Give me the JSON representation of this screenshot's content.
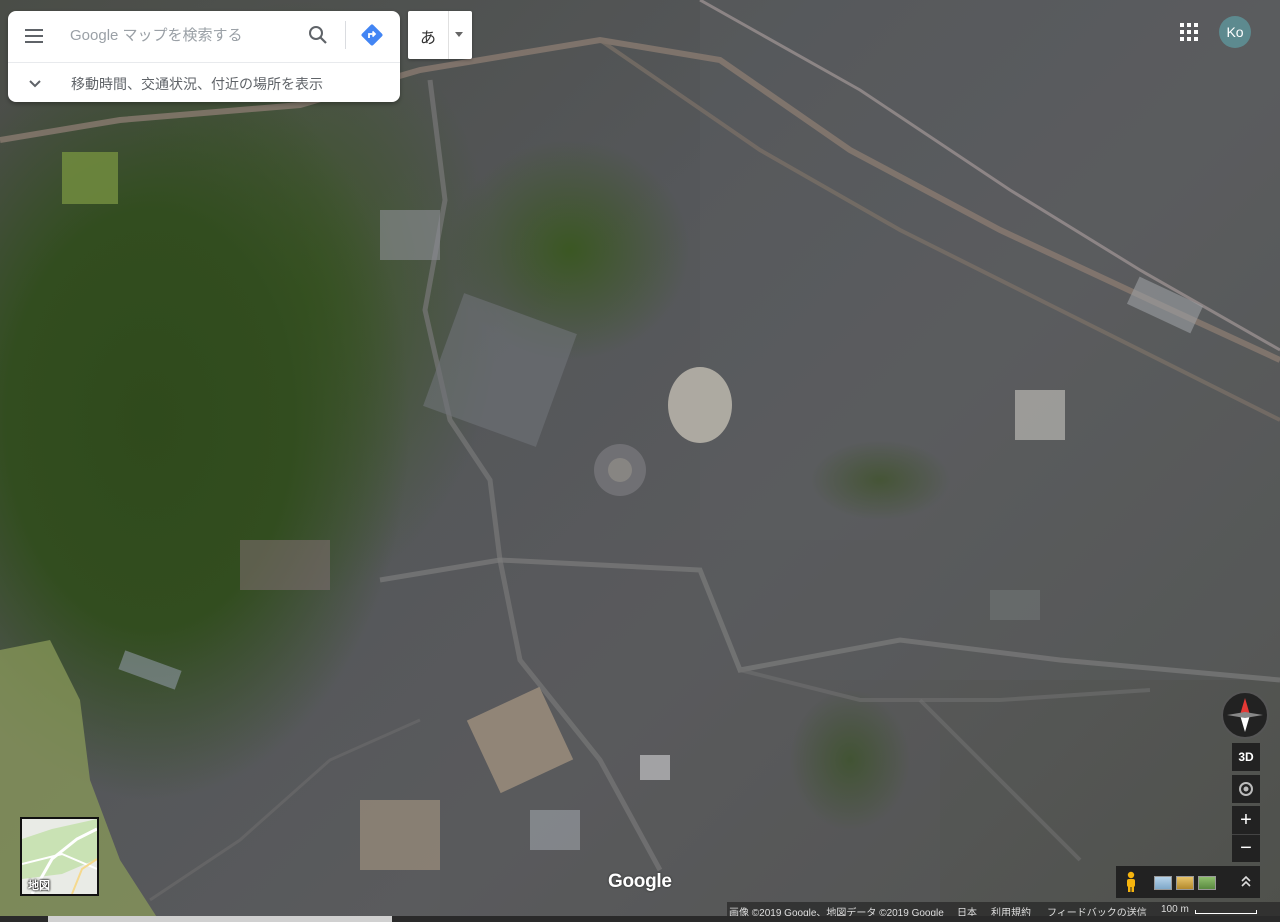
{
  "search": {
    "placeholder": "Google マップを検索する",
    "subline": "移動時間、交通状況、付近の場所を表示"
  },
  "ime": {
    "char": "あ"
  },
  "account": {
    "initials": "Ko"
  },
  "controls": {
    "three_d_label": "3D",
    "zoom_in_label": "+",
    "zoom_out_label": "−"
  },
  "minimap": {
    "label": "地図"
  },
  "logo": "Google",
  "attribution": {
    "imagery": "画像 ©2019 Google、地図データ ©2019 Google",
    "country": "日本",
    "terms": "利用規約",
    "feedback": "フィードバックの送信",
    "scale": "100 m"
  },
  "colors": {
    "accent_blue": "#4285f4",
    "compass_red": "#e53935",
    "avatar_bg": "#5d8a8f"
  },
  "icons": {
    "menu": "menu-icon",
    "search": "search-icon",
    "directions": "directions-icon",
    "expand": "chevron-down-icon",
    "apps": "apps-grid-icon",
    "compass": "compass-icon",
    "location": "my-location-icon",
    "pegman": "pegman-icon"
  }
}
